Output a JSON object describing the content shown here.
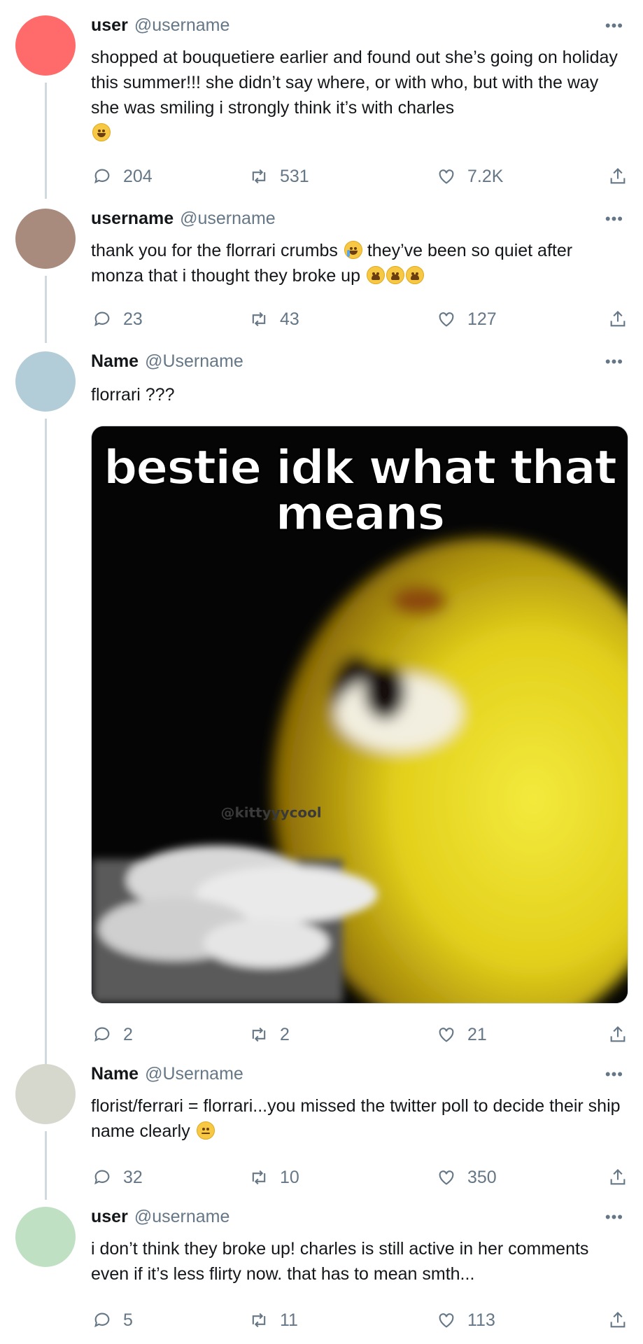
{
  "tweets": [
    {
      "name": "user",
      "handle": "@username",
      "avatar_color": "#ff6b6b",
      "text": "shopped at bouquetiere earlier and found out she’s going on holiday this summer!!! she didn’t say where, or with who, but with the way she was smiling i strongly think it’s with charles",
      "emoji": "grin-icon",
      "replies": "204",
      "retweets": "531",
      "likes": "7.2K"
    },
    {
      "name": "username",
      "handle": "@username",
      "avatar_color": "#a98b7e",
      "text_a": "thank you for the florrari crumbs",
      "text_b": "they’ve been so quiet after monza that i thought they broke up",
      "emoji_a": "crying-face-icon",
      "emoji_b": "weary-face-icon",
      "replies": "23",
      "retweets": "43",
      "likes": "127"
    },
    {
      "name": "Name",
      "handle": "@Username",
      "avatar_color": "#b3cdd8",
      "text": "florrari ???",
      "media": {
        "caption_line1": "bestie idk what that",
        "caption_line2": "means",
        "watermark": "@kittyyycool"
      },
      "replies": "2",
      "retweets": "2",
      "likes": "21"
    },
    {
      "name": "Name",
      "handle": "@Username",
      "avatar_color": "#d6d7cd",
      "text": "florist/ferrari = florrari...you missed the twitter poll to decide their ship name clearly",
      "emoji": "unamused-face-icon",
      "replies": "32",
      "retweets": "10",
      "likes": "350"
    },
    {
      "name": "user",
      "handle": "@username",
      "avatar_color": "#bfe0c3",
      "text": "i don’t think they broke up! charles is still active in her comments even if it’s less flirty now. that has to mean smth...",
      "replies": "5",
      "retweets": "11",
      "likes": "113"
    }
  ],
  "icons": {
    "more": "more-dots-icon",
    "reply": "reply-icon",
    "retweet": "retweet-icon",
    "like": "heart-icon",
    "share": "share-icon"
  },
  "more_glyph": "•••"
}
